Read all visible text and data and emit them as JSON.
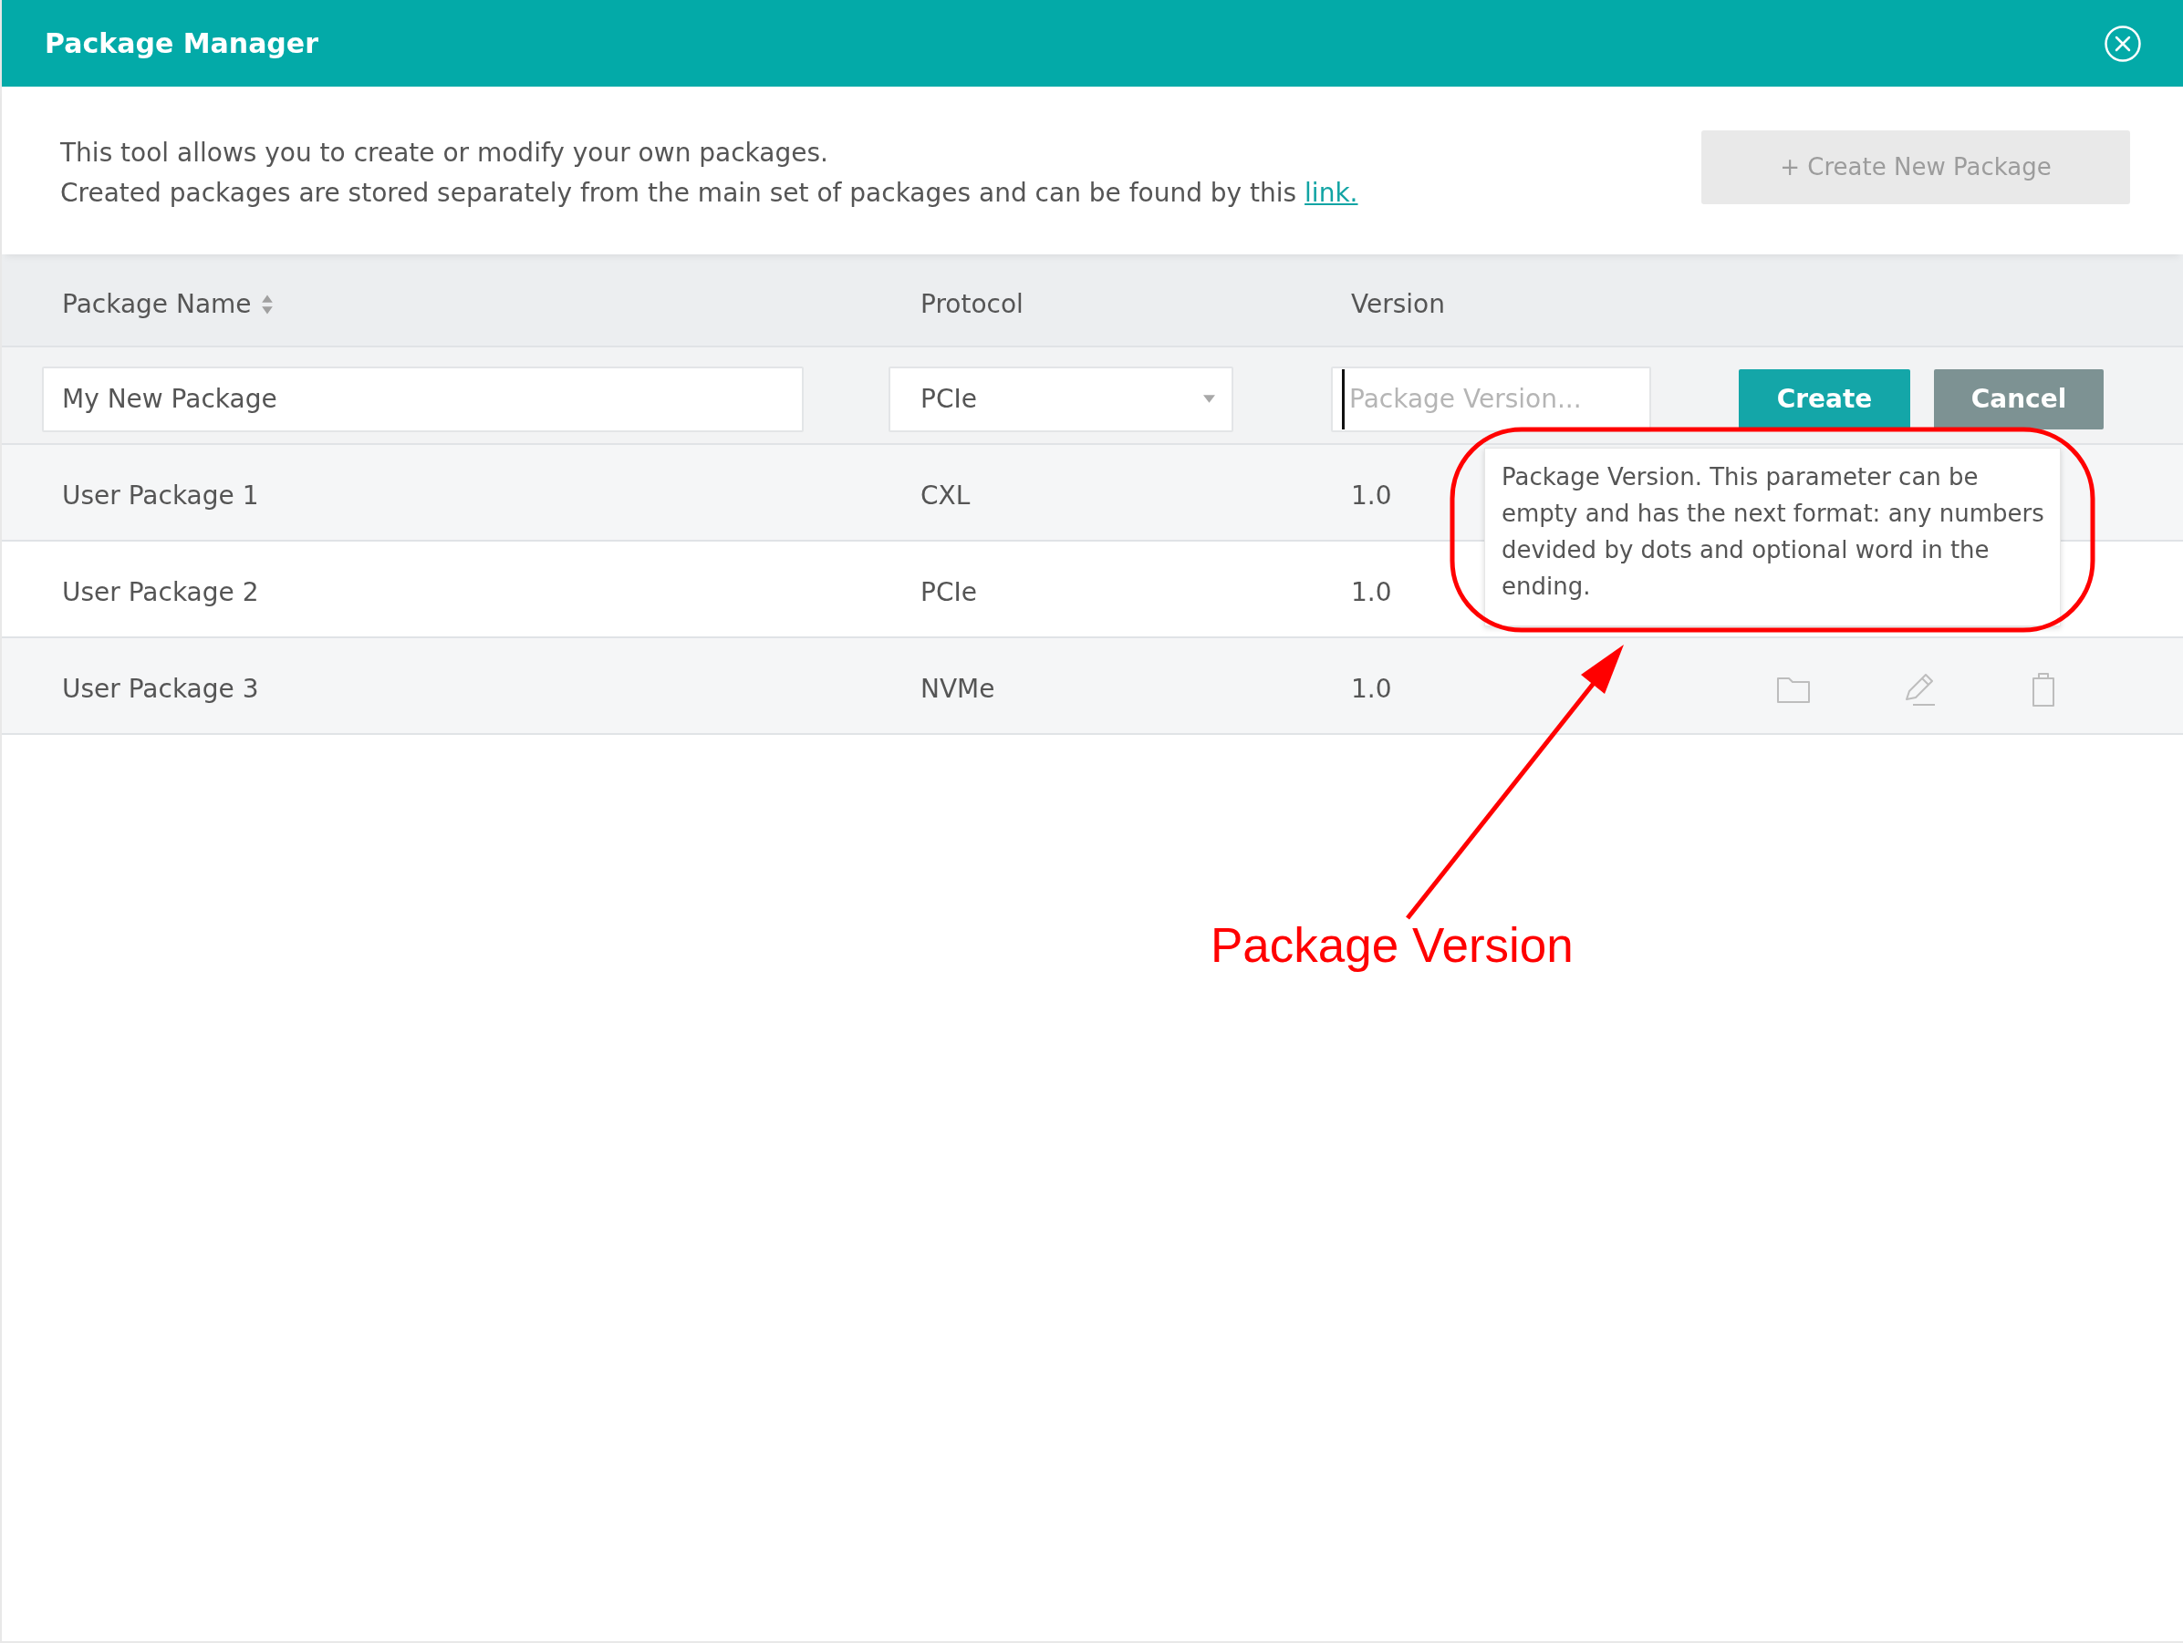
{
  "window": {
    "title": "Package Manager"
  },
  "intro": {
    "lines": [
      {
        "text": "This tool allows you to create or modify your own packages."
      },
      {
        "text": "Created packages are stored separately from the main set of packages and can be found by this",
        "link": "link."
      }
    ]
  },
  "create_package_button": {
    "label": "+ Create New Package",
    "disabled": true
  },
  "table": {
    "columns": [
      {
        "label": "Package Name",
        "sortable": true
      },
      {
        "label": "Protocol",
        "sortable": false
      },
      {
        "label": "Version",
        "sortable": false
      }
    ],
    "new_row": {
      "name_value": "My New Package",
      "protocol_value": "PCIe",
      "version_placeholder": "Package Version...",
      "version_focused": true,
      "buttons": [
        {
          "label": "Create",
          "kind": "primary"
        },
        {
          "label": "Cancel",
          "kind": "secondary"
        }
      ]
    },
    "rows": [
      {
        "name": "User Package 1",
        "protocol": "CXL",
        "version": "1.0"
      },
      {
        "name": "User Package 2",
        "protocol": "PCIe",
        "version": "1.0"
      },
      {
        "name": "User Package 3",
        "protocol": "NVMe",
        "version": "1.0",
        "actions_shown": true
      }
    ]
  },
  "tooltip": {
    "text": "Package Version. This parameter can be empty and has the next format: any numbers devided by dots and optional word in the ending."
  },
  "annotation": {
    "label": "Package Version"
  }
}
